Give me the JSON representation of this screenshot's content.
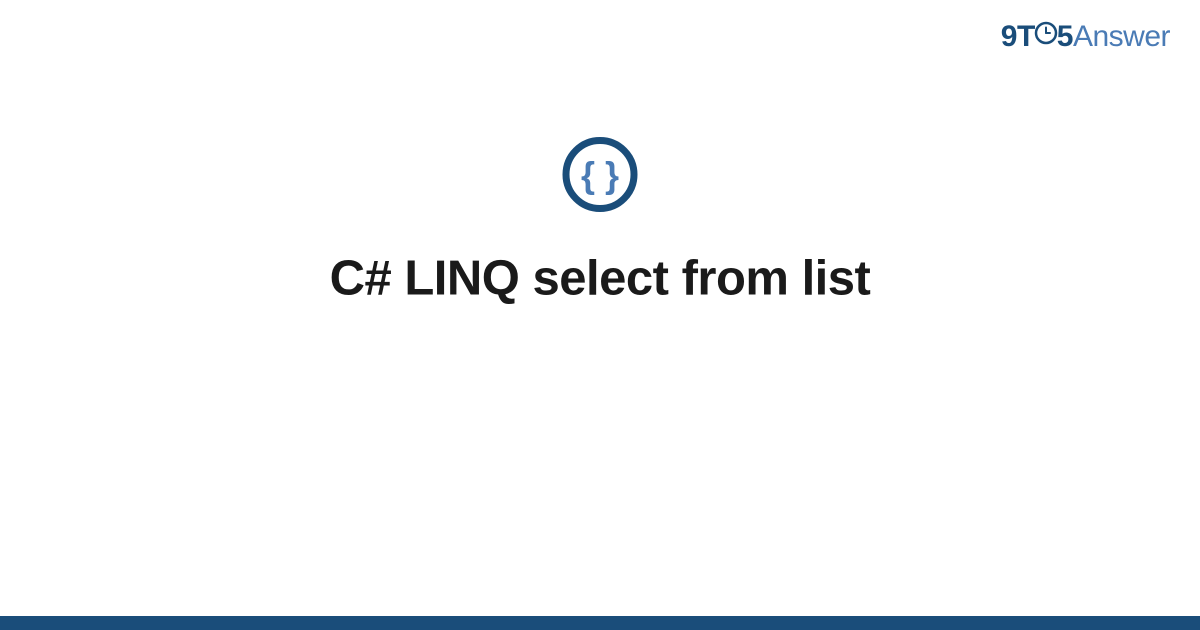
{
  "brand": {
    "prefix_nine": "9",
    "prefix_t": "T",
    "suffix_five": "5",
    "suffix_answer": "Answer"
  },
  "icon": {
    "name": "code-braces-icon"
  },
  "main": {
    "title": "C# LINQ select from list"
  },
  "colors": {
    "brand_dark": "#1a4d7a",
    "brand_light": "#4a7bb5",
    "text": "#1a1a1a",
    "footer": "#1a4d7a"
  }
}
